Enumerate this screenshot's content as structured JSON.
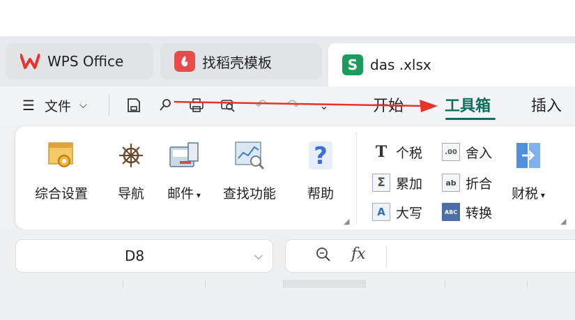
{
  "tabs": {
    "wps": {
      "label": "WPS Office",
      "icon": "wps-logo-icon"
    },
    "template": {
      "label": "找稻壳模板",
      "icon": "docer-logo-icon"
    },
    "document": {
      "label": "das .xlsx",
      "icon": "spreadsheet-logo-icon",
      "icon_letter": "S"
    }
  },
  "menu": {
    "file_label": "文件",
    "ribbon_tabs": [
      {
        "label": "开始"
      },
      {
        "label": "工具箱",
        "active": true
      },
      {
        "label": "插入"
      }
    ],
    "quick_icons": [
      "save-icon",
      "format-painter-icon",
      "print-icon",
      "print-preview-icon",
      "undo-icon",
      "redo-icon",
      "more-chevron-icon"
    ]
  },
  "ribbon": {
    "big_buttons": [
      {
        "label": "综合设置",
        "icon": "settings-window-icon"
      },
      {
        "label": "导航",
        "icon": "ship-wheel-icon"
      },
      {
        "label": "邮件",
        "icon": "mail-computer-icon",
        "dropdown": true
      },
      {
        "label": "查找功能",
        "icon": "search-chart-icon"
      },
      {
        "label": "帮助",
        "icon": "question-icon"
      }
    ],
    "small_buttons": [
      {
        "label": "个税",
        "icon": "tax-t-icon",
        "glyph": "T"
      },
      {
        "label": "舍入",
        "icon": "round-decimal-icon",
        "glyph": ".00"
      },
      {
        "label": "累加",
        "icon": "sum-icon",
        "glyph": "Σ"
      },
      {
        "label": "折合",
        "icon": "convert-fold-icon",
        "glyph": "ab"
      },
      {
        "label": "大写",
        "icon": "uppercase-icon",
        "glyph": "A"
      },
      {
        "label": "转换",
        "icon": "abc-123-icon",
        "glyph": "ABC"
      }
    ],
    "finance_button": {
      "label": "财税",
      "icon": "finance-book-icon",
      "dropdown": true
    }
  },
  "formula_bar": {
    "cell_ref": "D8",
    "fx_label": "fx",
    "formula_value": ""
  },
  "colors": {
    "accent": "#0e6e5c",
    "annotation_arrow": "#e8322a",
    "wps_red": "#e8322a",
    "sheet_green": "#1d9b5e"
  }
}
